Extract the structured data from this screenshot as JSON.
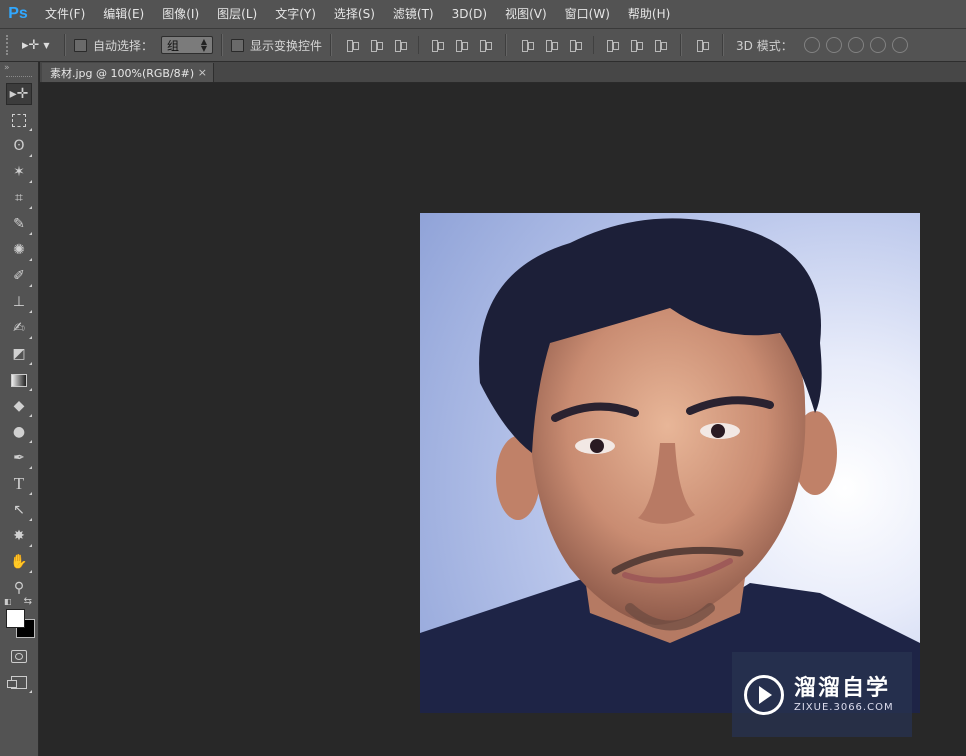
{
  "app": {
    "logo": "Ps"
  },
  "menu": [
    "文件(F)",
    "编辑(E)",
    "图像(I)",
    "图层(L)",
    "文字(Y)",
    "选择(S)",
    "滤镜(T)",
    "3D(D)",
    "视图(V)",
    "窗口(W)",
    "帮助(H)"
  ],
  "options": {
    "tool_icon": "move-tool-icon",
    "auto_select_label": "自动选择：",
    "auto_select_value": "组",
    "show_transform_label": "显示变换控件",
    "mode_3d_label": "3D 模式："
  },
  "toolbar": {
    "collapse_label": "»",
    "tools": [
      {
        "name": "move-tool",
        "glyph": "▸✛"
      },
      {
        "name": "marquee-tool",
        "glyph": ""
      },
      {
        "name": "lasso-tool",
        "glyph": "ʘ"
      },
      {
        "name": "magic-wand-tool",
        "glyph": "✶"
      },
      {
        "name": "crop-tool",
        "glyph": "⌗"
      },
      {
        "name": "eyedropper-tool",
        "glyph": "✎"
      },
      {
        "name": "healing-brush-tool",
        "glyph": "✺"
      },
      {
        "name": "brush-tool",
        "glyph": "✐"
      },
      {
        "name": "stamp-tool",
        "glyph": "⊥"
      },
      {
        "name": "history-brush-tool",
        "glyph": "✍"
      },
      {
        "name": "eraser-tool",
        "glyph": "◩"
      },
      {
        "name": "gradient-tool",
        "glyph": ""
      },
      {
        "name": "blur-tool",
        "glyph": "◆"
      },
      {
        "name": "dodge-tool",
        "glyph": "●"
      },
      {
        "name": "pen-tool",
        "glyph": "✒"
      },
      {
        "name": "type-tool",
        "glyph": "T"
      },
      {
        "name": "path-selection-tool",
        "glyph": "↖"
      },
      {
        "name": "shape-tool",
        "glyph": "✸"
      },
      {
        "name": "hand-tool",
        "glyph": "✋"
      },
      {
        "name": "zoom-tool",
        "glyph": "⚲"
      }
    ],
    "foreground_color": "#ffffff",
    "background_color": "#000000"
  },
  "document": {
    "tab_title": "素材.jpg @ 100%(RGB/8#)",
    "close": "×"
  },
  "watermark": {
    "title": "溜溜自学",
    "subtitle": "ZIXUE.3066.COM"
  }
}
